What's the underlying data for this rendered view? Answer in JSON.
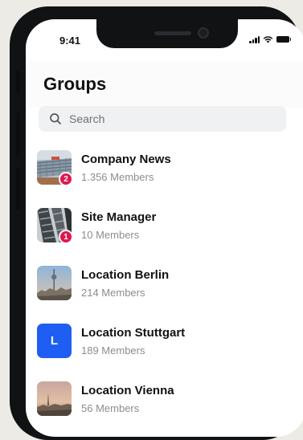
{
  "status_bar": {
    "time": "9:41"
  },
  "header": {
    "title": "Groups"
  },
  "search": {
    "placeholder": "Search"
  },
  "groups": [
    {
      "name": "Company News",
      "members": "1.356 Members",
      "badge": "2"
    },
    {
      "name": "Site Manager",
      "members": "10 Members",
      "badge": "1"
    },
    {
      "name": "Location Berlin",
      "members": "214 Members"
    },
    {
      "name": "Location Stuttgart",
      "members": "189 Members",
      "avatar_letter": "L"
    },
    {
      "name": "Location Vienna",
      "members": "56 Members"
    }
  ],
  "colors": {
    "badge": "#e0164e",
    "accent": "#1f5ef2"
  }
}
